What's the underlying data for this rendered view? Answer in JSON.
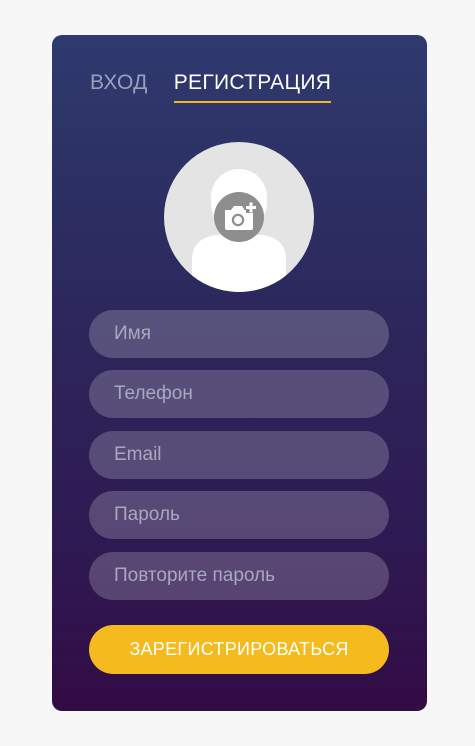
{
  "tabs": {
    "login_label": "ВХОД",
    "register_label": "РЕГИСТРАЦИЯ",
    "active": "register"
  },
  "avatar": {
    "placeholder_icon": "user-silhouette-icon",
    "upload_icon": "camera-add-icon"
  },
  "form": {
    "name_placeholder": "Имя",
    "phone_placeholder": "Телефон",
    "email_placeholder": "Email",
    "password_placeholder": "Пароль",
    "repeat_password_placeholder": "Повторите пароль",
    "submit_label": "ЗАРЕГИСТРИРОВАТЬСЯ"
  },
  "colors": {
    "background": "#f7f7f7",
    "card_gradient_top": "#2e3a6e",
    "card_gradient_bottom": "#330b45",
    "accent": "#f5bb1e",
    "tab_inactive": "#9aa0bd",
    "tab_active": "#ffffff"
  }
}
